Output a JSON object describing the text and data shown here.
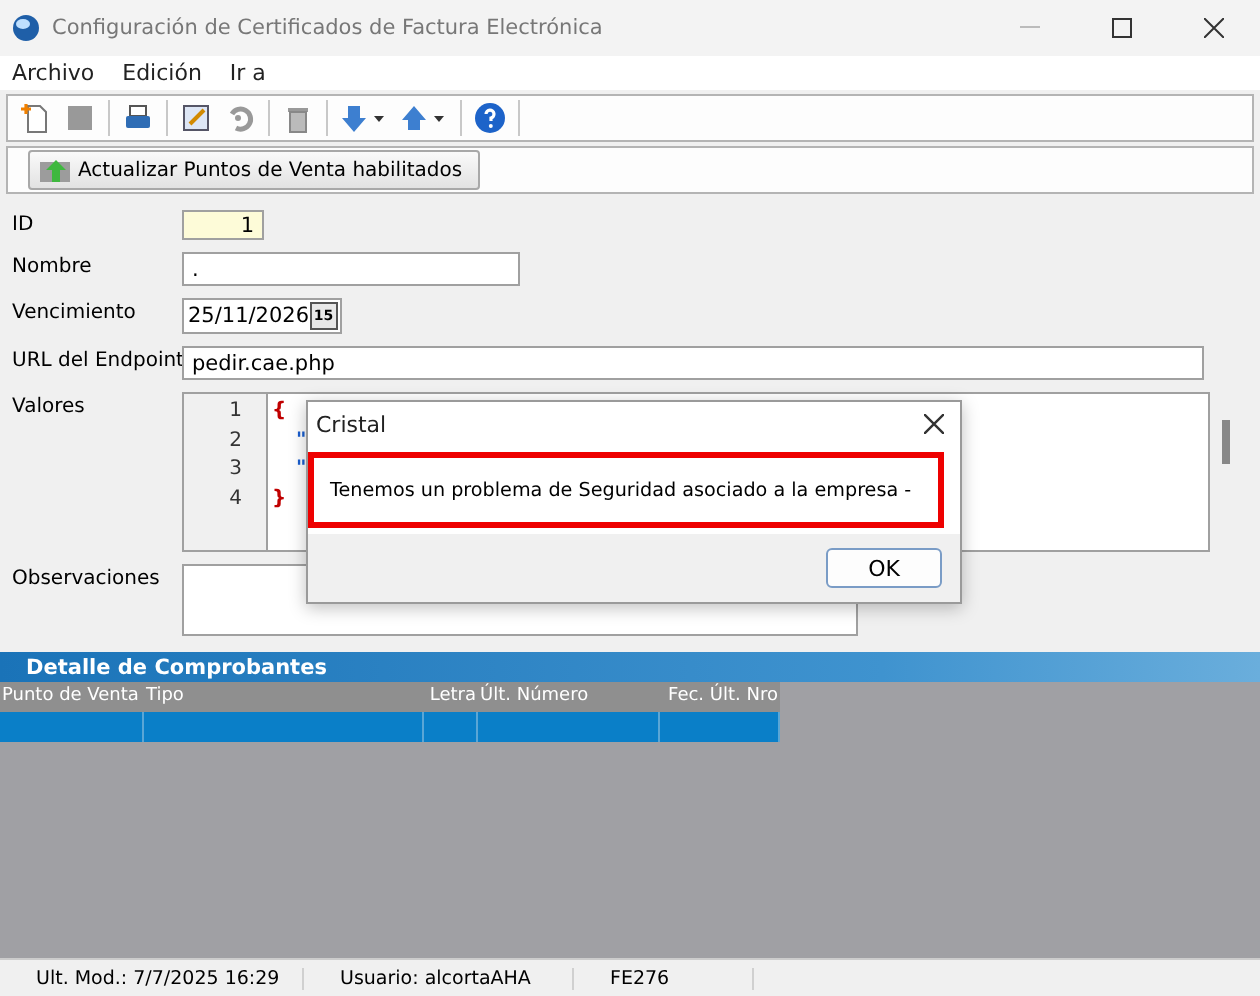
{
  "window": {
    "title": "Configuración de Certificados de Factura Electrónica"
  },
  "menu": [
    "Archivo",
    "Edición",
    "Ir a"
  ],
  "action_button": "Actualizar Puntos de Venta habilitados",
  "form": {
    "fields": [
      {
        "kind": "id",
        "label": "ID",
        "value": "1"
      },
      {
        "kind": "text",
        "label": "Nombre",
        "value": "."
      },
      {
        "kind": "date",
        "label": "Vencimiento",
        "value": "25/11/2026",
        "picker": "15"
      },
      {
        "kind": "url",
        "label": "URL del Endpoint",
        "value": "pedir.cae.php"
      },
      {
        "kind": "code",
        "label": "Valores",
        "lines": [
          {
            "number": "1",
            "text": "{",
            "kind": "brace"
          },
          {
            "number": "2",
            "text": "\"",
            "kind": "key"
          },
          {
            "number": "3",
            "text": "\"",
            "kind": "key"
          },
          {
            "number": "4",
            "text": "}",
            "kind": "brace"
          }
        ]
      },
      {
        "kind": "memo",
        "label": "Observaciones"
      }
    ]
  },
  "grid": {
    "title": "Detalle de Comprobantes",
    "columns": [
      "Punto de Venta",
      "Tipo",
      "Letra",
      "Últ. Número",
      "Fec. Últ. Nro"
    ],
    "rows": [
      {
        "selected": true
      }
    ]
  },
  "status_bar": [
    "Ult. Mod.: 7/7/2025 16:29",
    "Usuario: alcortaAHA",
    "FE276"
  ],
  "dialog": {
    "title": "Cristal",
    "message": "Tenemos un problema de Seguridad asociado a la empresa -",
    "button": "OK",
    "highlighted": true
  }
}
